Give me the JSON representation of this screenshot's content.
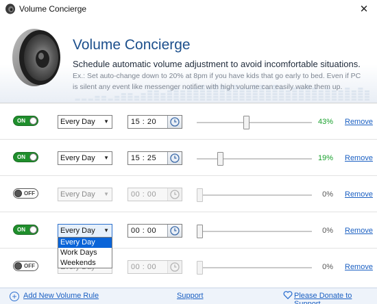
{
  "window": {
    "title": "Volume Concierge",
    "close_glyph": "✕"
  },
  "header": {
    "title": "Volume Concierge",
    "subtitle": "Schedule automatic volume adjustment to avoid incomfortable situations.",
    "example_prefix": "Ex.:",
    "example_text": " Set auto-change down to 20% at 8pm if you have kids that go early to bed. Even if PC is silent any event like messenger notifier with high volume can easily wake them up."
  },
  "rules": [
    {
      "enabled": true,
      "toggle_label": "ON",
      "schedule": "Every Day",
      "time": "15 : 20",
      "volume_percent": 43,
      "volume_label": "43%",
      "remove_label": "Remove"
    },
    {
      "enabled": true,
      "toggle_label": "ON",
      "schedule": "Every Day",
      "time": "15 : 25",
      "volume_percent": 19,
      "volume_label": "19%",
      "remove_label": "Remove"
    },
    {
      "enabled": false,
      "toggle_label": "OFF",
      "schedule": "Every Day",
      "time": "00 : 00",
      "volume_percent": 0,
      "volume_label": "0%",
      "remove_label": "Remove"
    },
    {
      "enabled": true,
      "toggle_label": "ON",
      "schedule": "Every Day",
      "time": "00 : 00",
      "volume_percent": 0,
      "volume_label": "0%",
      "remove_label": "Remove"
    },
    {
      "enabled": false,
      "toggle_label": "OFF",
      "schedule": "Every Day",
      "time": "00 : 00",
      "volume_percent": 0,
      "volume_label": "0%",
      "remove_label": "Remove"
    }
  ],
  "schedule_dropdown": {
    "options": [
      "Every Day",
      "Work Days",
      "Weekends"
    ],
    "highlighted": "Every Day"
  },
  "footer": {
    "add_label": "Add New Volume Rule",
    "support_label": "Support",
    "donate_label": "Please Donate to Support"
  },
  "icons": {
    "app": "speaker-icon",
    "clock": "clock-icon",
    "add": "plus-circle-icon",
    "donate": "heart-icon"
  },
  "colors": {
    "title_blue": "#1c4f8c",
    "toggle_on": "#1f8f2c",
    "percent_green": "#18a02c",
    "link_blue": "#1a5fc2",
    "dropdown_selected": "#0a64d8"
  }
}
